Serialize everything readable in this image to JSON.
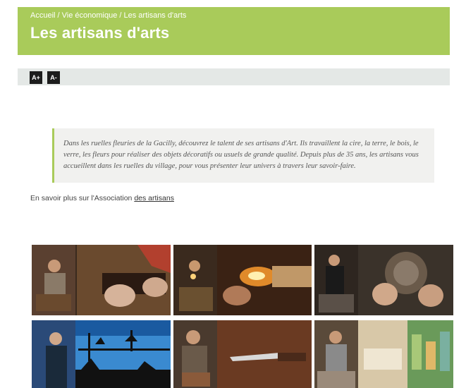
{
  "breadcrumb": {
    "home": "Accueil",
    "sep1": " / ",
    "section": "Vie économique",
    "sep2": " / ",
    "current": "Les artisans d'arts"
  },
  "page": {
    "title": "Les artisans d'arts"
  },
  "toolbar": {
    "increase_label": "A+",
    "decrease_label": "A-"
  },
  "intro": {
    "text": "Dans les ruelles fleuries de la Gacilly, découvrez le talent de ses artisans d'Art. Ils travaillent la cire, la terre, le bois, le verre, les fleurs pour réaliser des objets décoratifs ou usuels de grande qualité. Depuis plus de 35 ans, les artisans vous accueillent dans les ruelles du village, pour vous présenter leur univers à travers leur savoir-faire."
  },
  "more": {
    "prefix": "En savoir plus sur l'Association ",
    "link_label": "des artisans"
  },
  "gallery": {
    "items": [
      {
        "name": "leather-artisan",
        "colors": [
          "#6a4a2e",
          "#8a5a3a",
          "#b2402e"
        ]
      },
      {
        "name": "glass-artisan",
        "colors": [
          "#3a2a1e",
          "#c57a2a",
          "#f0c060"
        ]
      },
      {
        "name": "wood-turner",
        "colors": [
          "#2a2420",
          "#5a4a3a",
          "#8a7a6a"
        ]
      },
      {
        "name": "metal-silhouette-artisan",
        "colors": [
          "#1a3a6a",
          "#3a8ad0",
          "#111111"
        ]
      },
      {
        "name": "knife-maker",
        "colors": [
          "#4a3a2e",
          "#8a5a3a",
          "#c0c0c0"
        ]
      },
      {
        "name": "pottery-artisan",
        "colors": [
          "#5a4a3a",
          "#d8c8a8",
          "#6a9a5a"
        ]
      }
    ]
  }
}
